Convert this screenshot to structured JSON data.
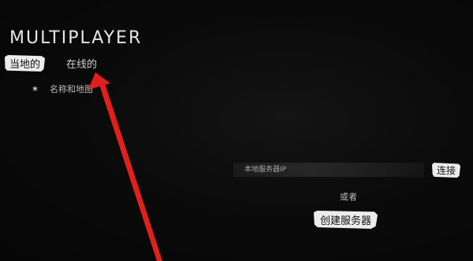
{
  "header": {
    "title": "MULTIPLAYER"
  },
  "tabs": [
    {
      "label": "当地的",
      "active": true
    },
    {
      "label": "在线的",
      "active": false
    }
  ],
  "sort": {
    "icon": "star-icon",
    "label": "名称和地图"
  },
  "connect": {
    "ip_placeholder": "本地服务器IP",
    "connect_label": "连接",
    "or_label": "或者",
    "create_label": "创建服务器"
  },
  "colors": {
    "background": "#000000",
    "highlight": "#ececec",
    "annotation_arrow": "#e0201c"
  }
}
